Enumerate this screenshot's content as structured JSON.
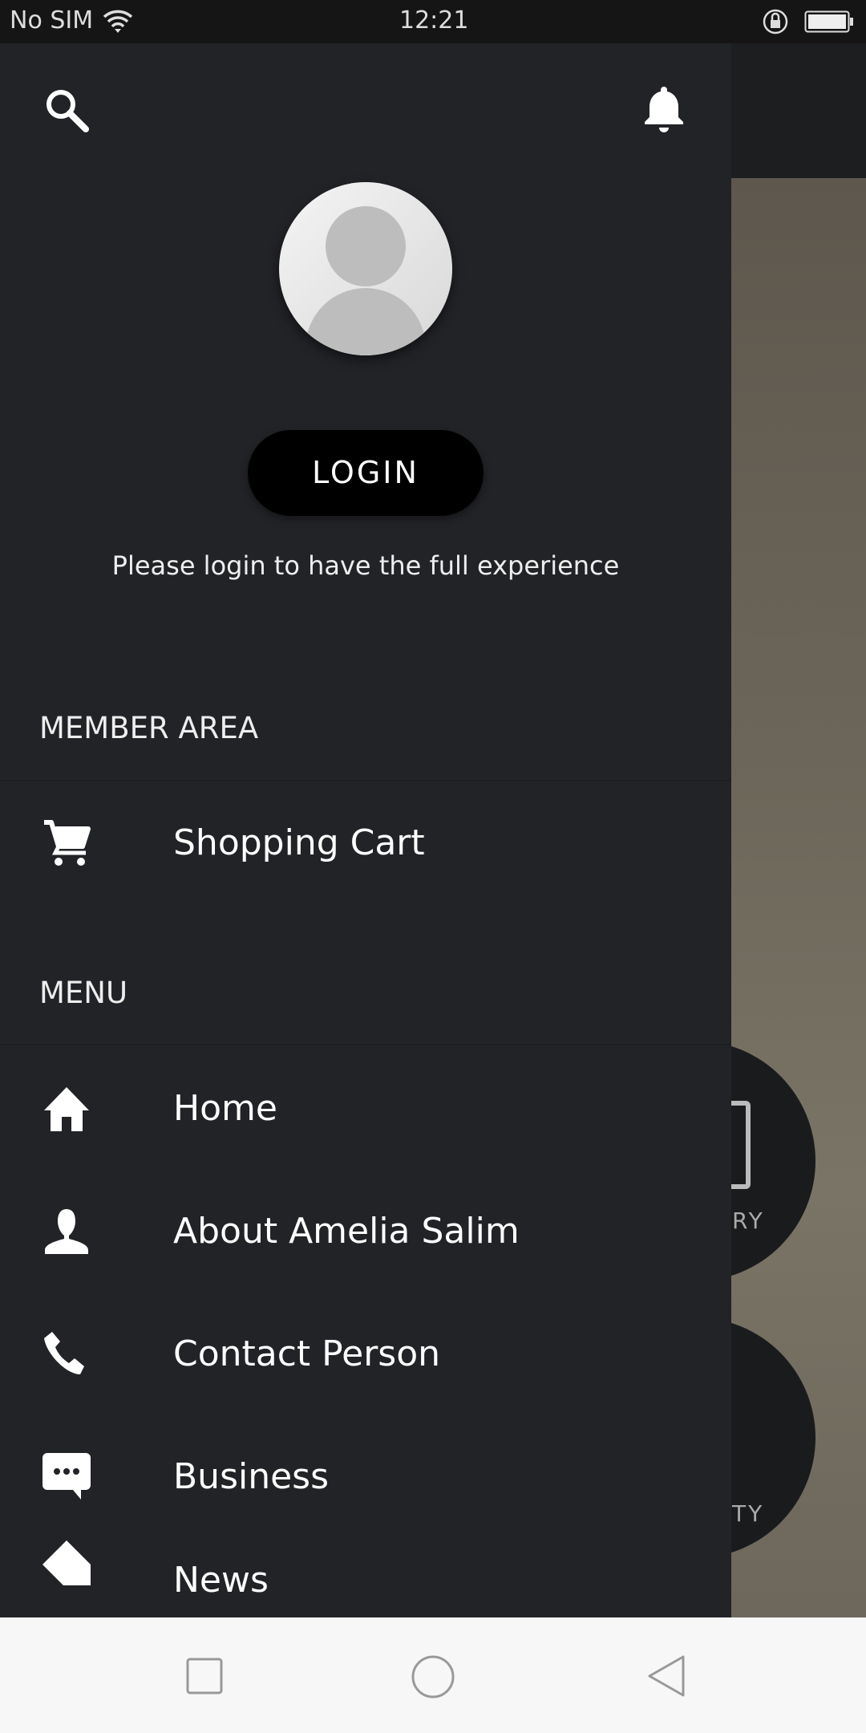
{
  "status_bar": {
    "carrier": "No SIM",
    "time": "12:21"
  },
  "drawer": {
    "login_label": "LOGIN",
    "login_prompt": "Please login to have the full experience",
    "member_area": {
      "title": "MEMBER AREA",
      "items": [
        {
          "label": "Shopping Cart",
          "icon": "cart-icon"
        }
      ]
    },
    "menu": {
      "title": "MENU",
      "items": [
        {
          "label": "Home",
          "icon": "home-icon"
        },
        {
          "label": "About Amelia Salim",
          "icon": "person-icon"
        },
        {
          "label": "Contact Person",
          "icon": "phone-icon"
        },
        {
          "label": "Business",
          "icon": "chat-icon"
        },
        {
          "label": "News",
          "icon": "news-icon"
        }
      ]
    }
  },
  "background": {
    "circle_labels": [
      "RY",
      "TY"
    ]
  },
  "colors": {
    "drawer_bg": "#222327",
    "login_button": "#000000"
  }
}
